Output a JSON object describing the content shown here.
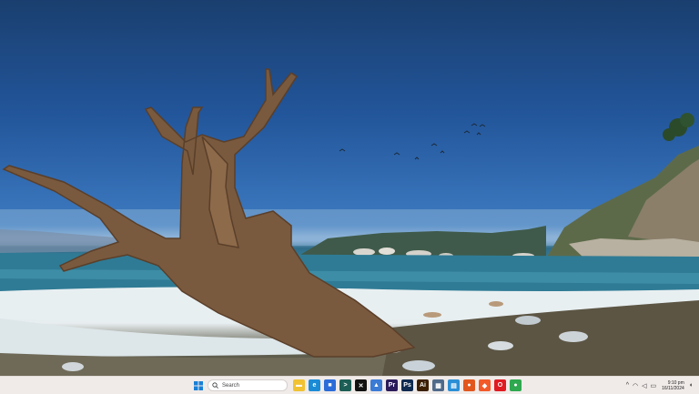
{
  "taskbar": {
    "search_placeholder": "Search",
    "apps": [
      {
        "name": "file-explorer",
        "color": "#f1c232",
        "glyph": "▬"
      },
      {
        "name": "edge",
        "color": "#1b8bd6",
        "glyph": "e"
      },
      {
        "name": "store",
        "color": "#2b6cd8",
        "glyph": "■"
      },
      {
        "name": "terminal",
        "color": "#1c5e55",
        "glyph": ">"
      },
      {
        "name": "capcut",
        "color": "#111111",
        "glyph": "✕"
      },
      {
        "name": "photos",
        "color": "#3a7bd5",
        "glyph": "▲"
      },
      {
        "name": "premiere-pro",
        "color": "#2c1b5a",
        "glyph": "Pr"
      },
      {
        "name": "photoshop",
        "color": "#0f2b50",
        "glyph": "Ps"
      },
      {
        "name": "illustrator",
        "color": "#3b1f00",
        "glyph": "Ai"
      },
      {
        "name": "calculator",
        "color": "#4f6a8a",
        "glyph": "▦"
      },
      {
        "name": "notepad",
        "color": "#2b8fd6",
        "glyph": "▤"
      },
      {
        "name": "firefox",
        "color": "#e2571e",
        "glyph": "●"
      },
      {
        "name": "brave",
        "color": "#f35a2a",
        "glyph": "◆"
      },
      {
        "name": "opera",
        "color": "#e01b22",
        "glyph": "O"
      },
      {
        "name": "chrome",
        "color": "#2fa84f",
        "glyph": "●"
      }
    ],
    "clock": {
      "time": "9:10 pm",
      "date": "16/11/2024"
    }
  }
}
